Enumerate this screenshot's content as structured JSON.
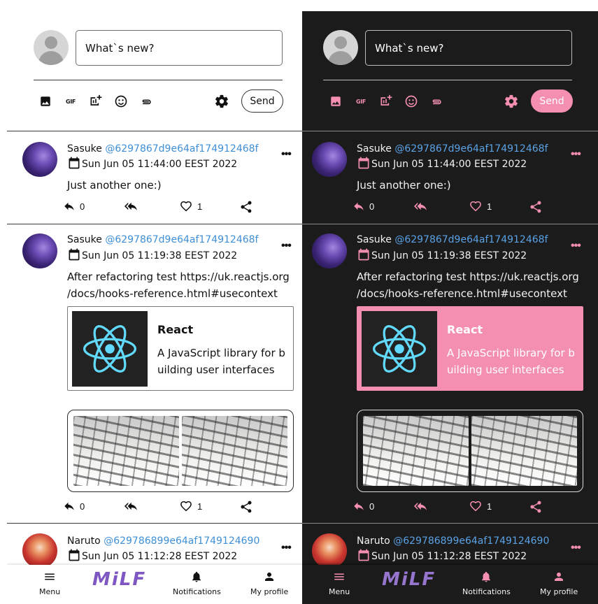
{
  "compose": {
    "placeholder": "What`s new?",
    "send_label": "Send",
    "icons": [
      "image-icon",
      "gif-icon",
      "poll-icon",
      "emoji-icon",
      "attach-icon",
      "gear-icon"
    ]
  },
  "posts": [
    {
      "author": "Sasuke",
      "handle": "@6297867d9e64af174912468f",
      "date": "Sun Jun 05 11:44:00 EEST 2022",
      "text_lines": [
        "Just another one:)"
      ],
      "reply_count": "0",
      "like_count": "1"
    },
    {
      "author": "Sasuke",
      "handle": "@6297867d9e64af174912468f",
      "date": "Sun Jun 05 11:19:38 EEST 2022",
      "text_lines": [
        "After refactoring test https://uk.reactjs.org",
        "/docs/hooks-reference.html#usecontext"
      ],
      "link_preview": {
        "title": "React",
        "description": "A JavaScript library for building user interfaces"
      },
      "reply_count": "0",
      "like_count": "1"
    },
    {
      "author": "Naruto",
      "handle": "@629786899e64af1749124690",
      "date": "Sun Jun 05 11:12:28 EEST 2022"
    }
  ],
  "nav": {
    "menu": "Menu",
    "logo": "MiLF",
    "notifications": "Notifications",
    "profile": "My profile"
  },
  "colors": {
    "accent_pink": "#f48fb1",
    "link_blue": "#3f8fd8",
    "logo_purple": "#7e57c2",
    "dark_bg": "#1b1b1b"
  }
}
